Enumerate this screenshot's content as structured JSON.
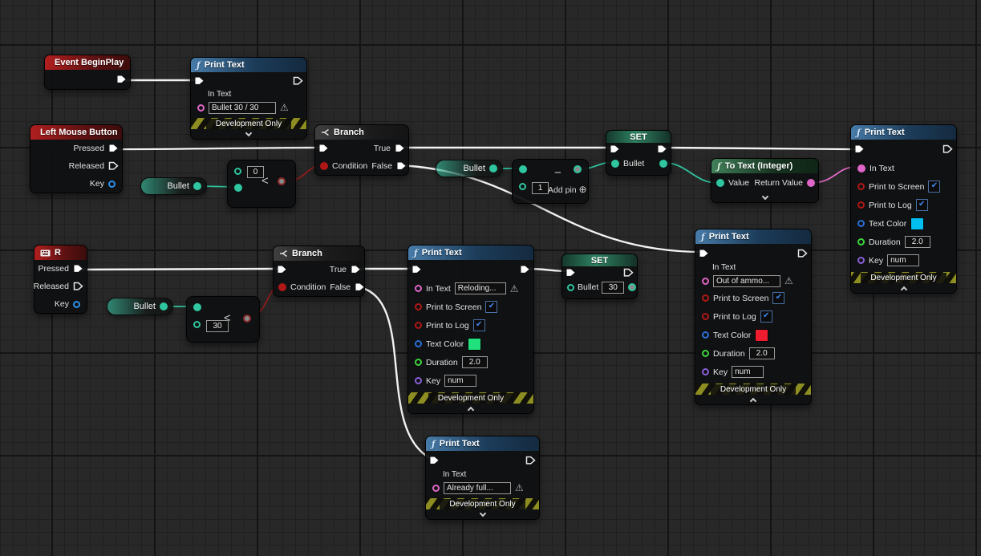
{
  "icons": {
    "warning": "⚠",
    "check": "✔",
    "add_pin": "⊕"
  },
  "colors": {
    "exec_wire": "#f2f2f2",
    "int_wire": "#2fc6a0",
    "bool_wire": "#8a1d1d",
    "text_wire": "#e06ac8",
    "cyan_swatch": "#00bfef",
    "green_swatch": "#20e17c",
    "red_swatch": "#ee1c2e"
  },
  "nodes": {
    "event_begin_play": {
      "title": "Event BeginPlay"
    },
    "left_mouse_button": {
      "title": "Left Mouse Button",
      "pressed": "Pressed",
      "released": "Released",
      "key": "Key"
    },
    "r_key": {
      "title": "R",
      "pressed": "Pressed",
      "released": "Released",
      "key": "Key"
    },
    "bullet_var": {
      "label": "Bullet"
    },
    "branch": {
      "title": "Branch",
      "condition": "Condition",
      "true_label": "True",
      "false_label": "False"
    },
    "compare_zero": {
      "operator": "<",
      "literal": "0"
    },
    "compare_thirty": {
      "operator": "<",
      "literal": "30"
    },
    "subtract": {
      "operator": "−",
      "literal": "1",
      "add_pin_label": "Add pin"
    },
    "set_bullet": {
      "title": "SET",
      "var_label": "Bullet"
    },
    "set_bullet_30": {
      "title": "SET",
      "var_label": "Bullet",
      "literal": "30"
    },
    "to_text_integer": {
      "title": "To Text (Integer)",
      "value_label": "Value",
      "return_label": "Return Value"
    },
    "print_text_labels": {
      "title": "Print Text",
      "in_text": "In Text",
      "print_to_screen": "Print to Screen",
      "print_to_log": "Print to Log",
      "text_color": "Text Color",
      "duration": "Duration",
      "key": "Key",
      "footer": "Development Only"
    },
    "print_text_initial": {
      "in_text_value": "Bullet 30 / 30"
    },
    "print_text_ammo": {
      "duration_value": "2.0",
      "key_value": "num",
      "swatch_style": "background:#00bfef"
    },
    "print_text_reloading": {
      "in_text_value": "Reloding...",
      "duration_value": "2.0",
      "key_value": "num",
      "swatch_style": "background:#20e17c"
    },
    "print_text_out_of_ammo": {
      "in_text_value": "Out of ammo...",
      "duration_value": "2.0",
      "key_value": "num",
      "swatch_style": "background:#ee1c2e"
    },
    "print_text_already_full": {
      "in_text_value": "Already full..."
    }
  }
}
